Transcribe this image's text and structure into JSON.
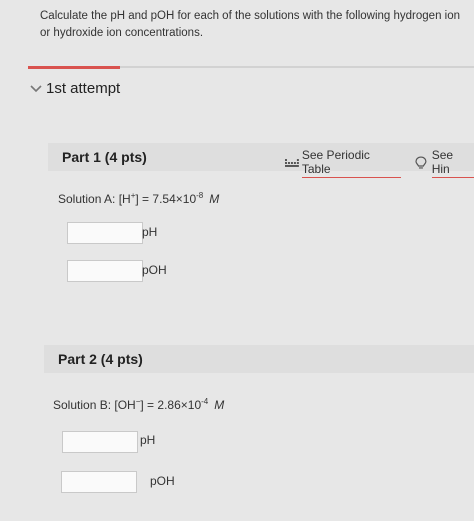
{
  "question": "Calculate the pH and pOH for each of the solutions with the following hydrogen ion or hydroxide ion concentrations.",
  "attempt": {
    "label": "1st attempt"
  },
  "tools": {
    "periodic_table": "See Periodic Table",
    "hint": "See Hin"
  },
  "parts": [
    {
      "title": "Part 1 (4 pts)",
      "solution": {
        "prefix": "Solution A:  [H",
        "charge": "+",
        "mid": "] = 7.54×10",
        "exp": "-8",
        "unit": "M"
      },
      "fields": [
        {
          "label": "pH",
          "value": ""
        },
        {
          "label": "pOH",
          "value": ""
        }
      ]
    },
    {
      "title": "Part 2 (4 pts)",
      "solution": {
        "prefix": "Solution B: [OH",
        "charge": "−",
        "mid": "] = 2.86×10",
        "exp": "-4",
        "unit": "M"
      },
      "fields": [
        {
          "label": "pH",
          "value": ""
        },
        {
          "label": "pOH",
          "value": ""
        }
      ]
    }
  ],
  "colors": {
    "accent": "#d9534f",
    "background": "#e7e7e7",
    "header": "#dedede"
  }
}
